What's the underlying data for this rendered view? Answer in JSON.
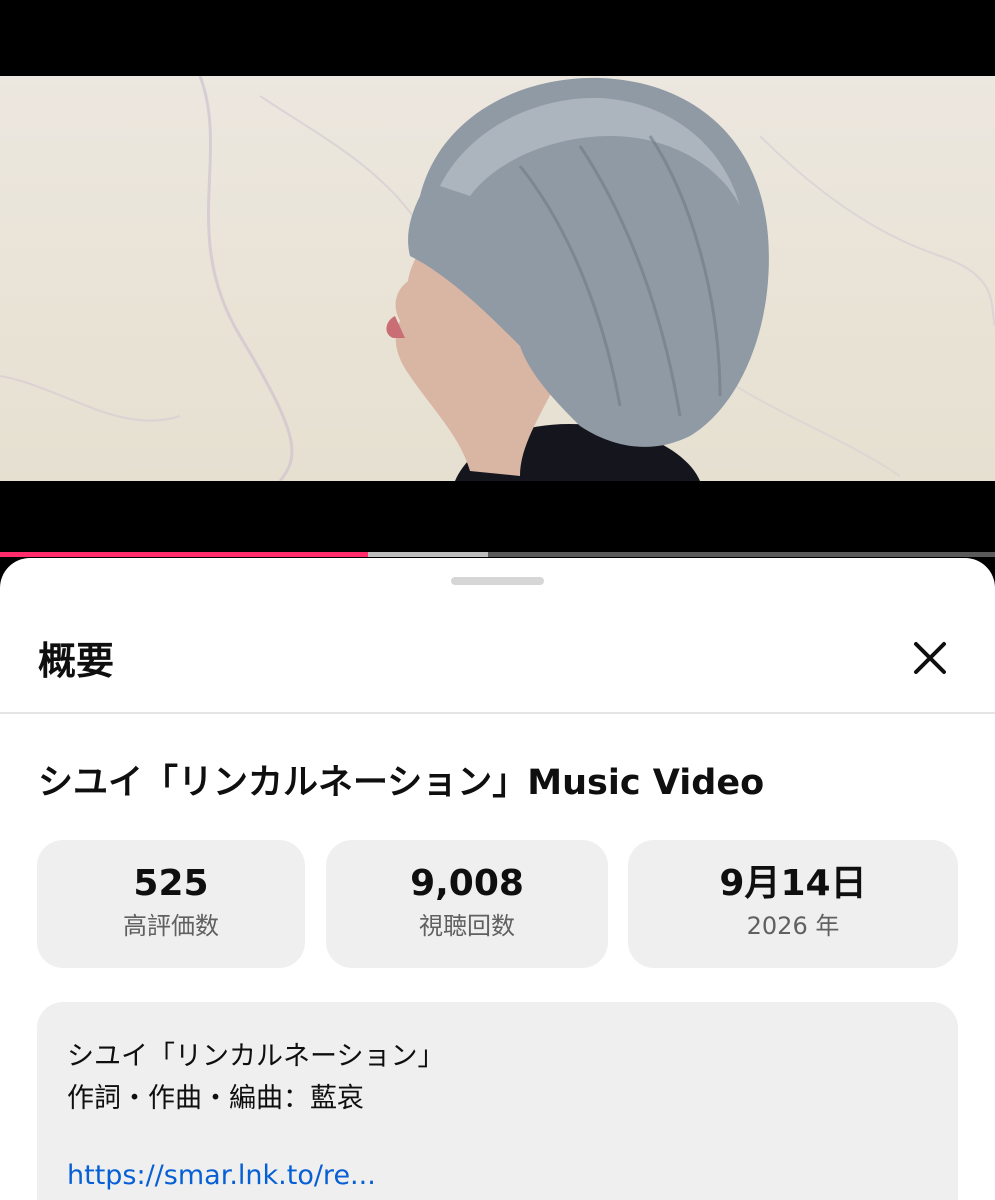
{
  "player": {
    "progress_played_fraction": 0.37,
    "progress_buffered_fraction": 0.49,
    "accent_color": "#ff2b6a"
  },
  "sheet": {
    "title": "概要",
    "close_icon": "close-icon",
    "video_title": "シユイ「リンカルネーション」Music Video"
  },
  "stats": {
    "likes": {
      "value": "525",
      "label": "高評価数"
    },
    "views": {
      "value": "9,008",
      "label": "視聴回数"
    },
    "date": {
      "value": "9月14日",
      "label": "2026 年"
    }
  },
  "description": {
    "line1": "シユイ「リンカルネーション」",
    "line2": "作詞・作曲・編曲：藍哀",
    "link": "https://smar.lnk.to/re..."
  },
  "colors": {
    "link": "#065fd4",
    "card_bg": "#efefef"
  }
}
